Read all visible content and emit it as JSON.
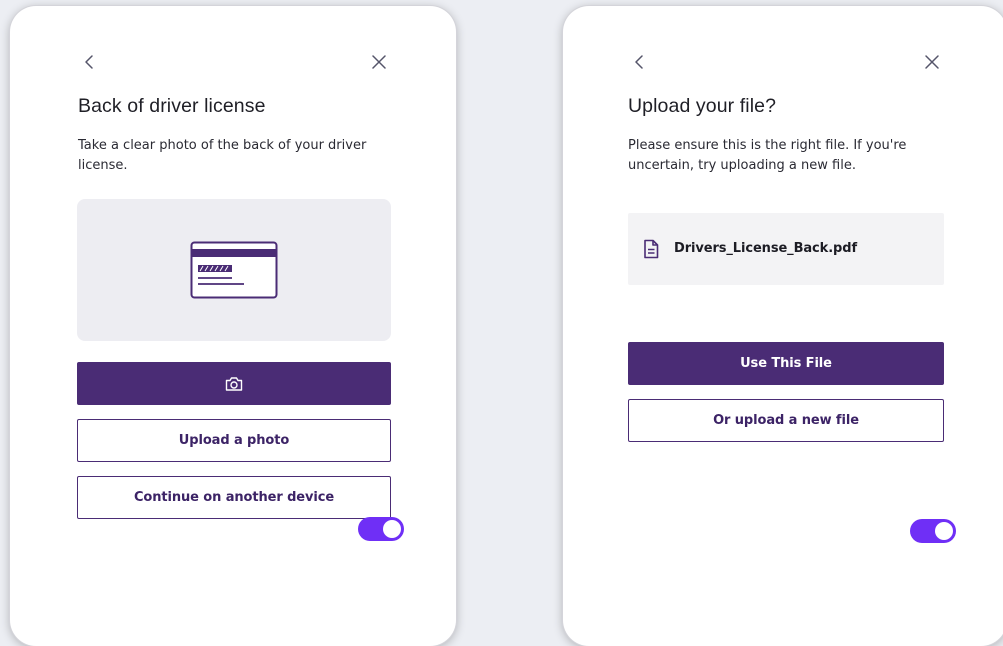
{
  "left_card": {
    "title": "Back of driver license",
    "description": "Take a clear photo of the back of your driver license.",
    "illustration_icon": "id-card-back-icon",
    "camera_button_icon": "camera-icon",
    "upload_button_label": "Upload a photo",
    "continue_button_label": "Continue on another device",
    "toggle_on": true
  },
  "right_card": {
    "title": "Upload your file?",
    "description": "Please ensure this is the right file. If you're uncertain, try uploading a new file.",
    "file_icon": "document-icon",
    "file_name": "Drivers_License_Back.pdf",
    "use_button_label": "Use This File",
    "new_file_button_label": "Or upload a new file",
    "toggle_on": true
  },
  "icons": {
    "back": "chevron-left-icon",
    "close": "close-icon"
  },
  "colors": {
    "primary": "#4a2c75",
    "toggle": "#6f2ff6",
    "background": "#eceef3",
    "preview_bg": "#ededf2",
    "file_box_bg": "#f3f3f5"
  }
}
